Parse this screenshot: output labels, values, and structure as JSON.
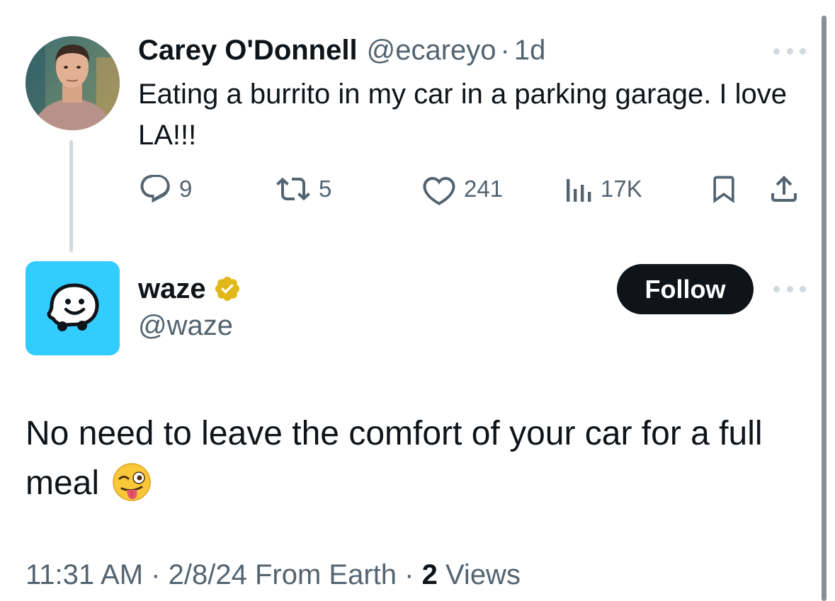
{
  "original_tweet": {
    "display_name": "Carey O'Donnell",
    "handle": "@ecareyo",
    "separator": "·",
    "age": "1d",
    "text": "Eating a burrito in my car in a parking garage. I love LA!!!",
    "actions": {
      "replies": "9",
      "reposts": "5",
      "likes": "241",
      "views": "17K"
    }
  },
  "reply": {
    "display_name": "waze",
    "handle": "@waze",
    "follow_label": "Follow",
    "verified_color": "#e2b719",
    "text": "No need to leave the comfort of your car for a full meal",
    "emoji": "😜",
    "meta": {
      "time": "11:31 AM",
      "separator": "·",
      "date": "2/8/24",
      "source": "From Earth",
      "separator2": "·",
      "views_count": "2",
      "views_label": "Views"
    }
  },
  "colors": {
    "text": "#0f1419",
    "secondary": "#536471",
    "waze_brand": "#33ccff",
    "follow_bg": "#0f1419"
  }
}
